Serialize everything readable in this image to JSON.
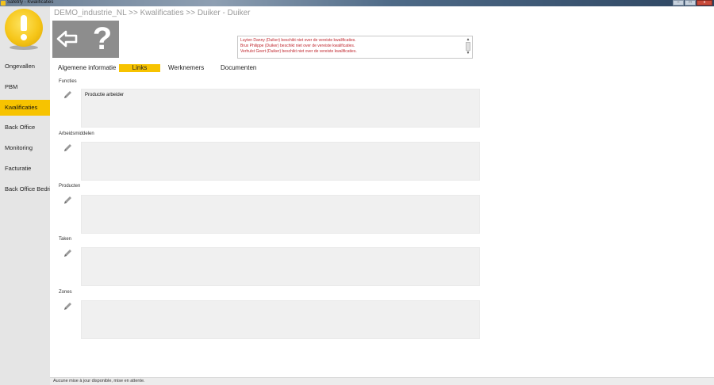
{
  "window": {
    "title": "Safetify - Kwalificaties",
    "minimize_label": "–",
    "maximize_label": "□",
    "close_label": "x"
  },
  "sidebar": {
    "items": [
      {
        "label": "Ongevallen",
        "active": false
      },
      {
        "label": "PBM",
        "active": false
      },
      {
        "label": "Kwalificaties",
        "active": true
      },
      {
        "label": "Back Office",
        "active": false
      },
      {
        "label": "Monitoring",
        "active": false
      },
      {
        "label": "Facturatie",
        "active": false
      },
      {
        "label": "Back Office Bedrijf",
        "active": false
      }
    ]
  },
  "breadcrumb": "DEMO_industrie_NL >> Kwalificaties >> Duiker - Duiker",
  "toolbar": {
    "help_label": "?"
  },
  "messages": [
    "Luyten Danny (Duiker) beschikt niet over de vereiste kwalificaties.",
    "Brux Philippe (Duiker) beschikt niet over de vereiste kwalificaties.",
    "Verhulst Geert (Duiker) beschikt niet over de vereiste kwalificaties."
  ],
  "message_scroll": {
    "up": "▲",
    "down": "▼"
  },
  "tabs": [
    {
      "label": "Algemene informatie",
      "active": false
    },
    {
      "label": "Links",
      "active": true
    },
    {
      "label": "Werknemers",
      "active": false
    },
    {
      "label": "Documenten",
      "active": false
    }
  ],
  "sections": [
    {
      "label": "Functies",
      "items": [
        "Productie arbeider"
      ]
    },
    {
      "label": "Arbeidsmiddelen",
      "items": []
    },
    {
      "label": "Producten",
      "items": []
    },
    {
      "label": "Taken",
      "items": []
    },
    {
      "label": "Zones",
      "items": []
    }
  ],
  "status": "Aucune mise à jour disponible, mise en attente.",
  "colors": {
    "accent": "#f7c300",
    "message_text": "#c0282f",
    "sidebar_bg": "#e5e5e5",
    "box_bg": "#f0f0f0"
  }
}
